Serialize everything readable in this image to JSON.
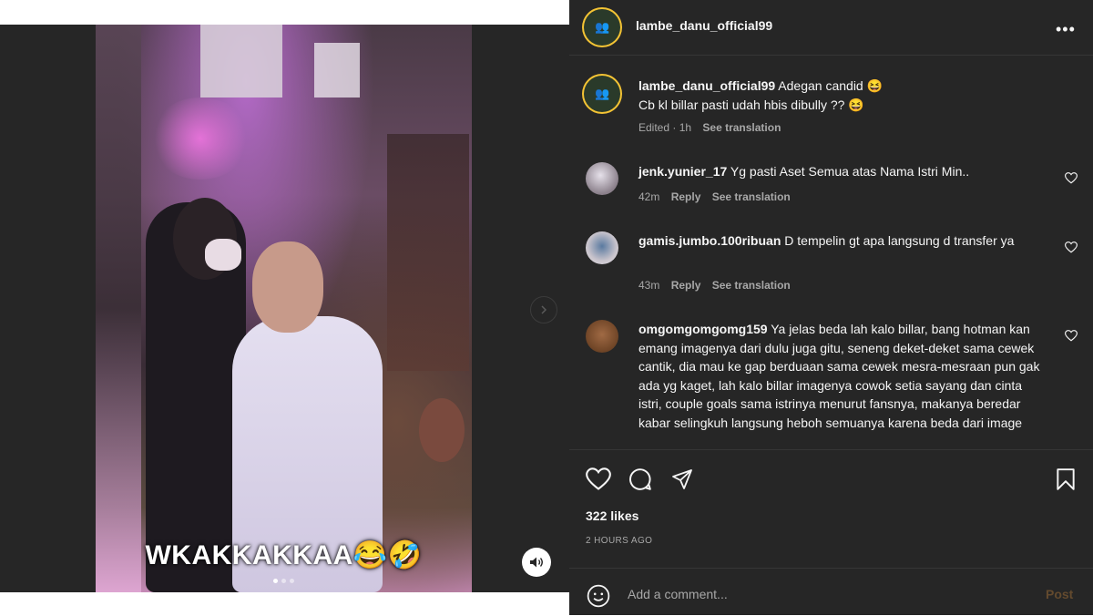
{
  "post": {
    "username": "lambe_danu_official99",
    "caption_text": "Adegan candid 😆\nCb kl billar pasti udah hbis dibully ?? 😆",
    "caption_line1": "Adegan candid 😆",
    "caption_line2": "Cb kl billar pasti udah hbis dibully ?? 😆",
    "edited": "Edited · 1h",
    "see_translation": "See translation",
    "likes": "322 likes",
    "timestamp": "2 HOURS AGO",
    "more_icon": "•••"
  },
  "media": {
    "overlay_text": "WKAKKAKKAA😂🤣",
    "slide_count": 3,
    "active_slide": 1
  },
  "comments": [
    {
      "user": "jenk.yunier_17",
      "text": "Yg pasti Aset Semua atas Nama Istri Min..",
      "time": "42m",
      "reply": "Reply",
      "translate": "See translation"
    },
    {
      "user": "gamis.jumbo.100ribuan",
      "text": "D tempelin gt apa langsung d transfer ya",
      "time": "43m",
      "reply": "Reply",
      "translate": "See translation"
    },
    {
      "user": "omgomgomgomg159",
      "text": "Ya jelas beda lah kalo billar, bang hotman kan emang imagenya dari dulu juga gitu, seneng deket-deket sama cewek cantik, dia mau ke gap berduaan sama cewek mesra-mesraan pun gak ada yg kaget, lah kalo billar imagenya cowok setia sayang dan cinta istri, couple goals sama istrinya menurut fansnya, makanya beredar kabar selingkuh langsung heboh semuanya karena beda dari image"
    }
  ],
  "composer": {
    "placeholder": "Add a comment...",
    "post_label": "Post"
  },
  "colors": {
    "panel_bg": "#262626",
    "divider": "#363636",
    "muted_text": "#a8a8a8",
    "post_disabled": "#634a2e",
    "story_ring": "#f3c334"
  },
  "icons": [
    "more-icon",
    "heart-icon",
    "comment-icon",
    "share-icon",
    "save-icon",
    "emoji-icon",
    "volume-icon",
    "chevron-right-icon"
  ]
}
